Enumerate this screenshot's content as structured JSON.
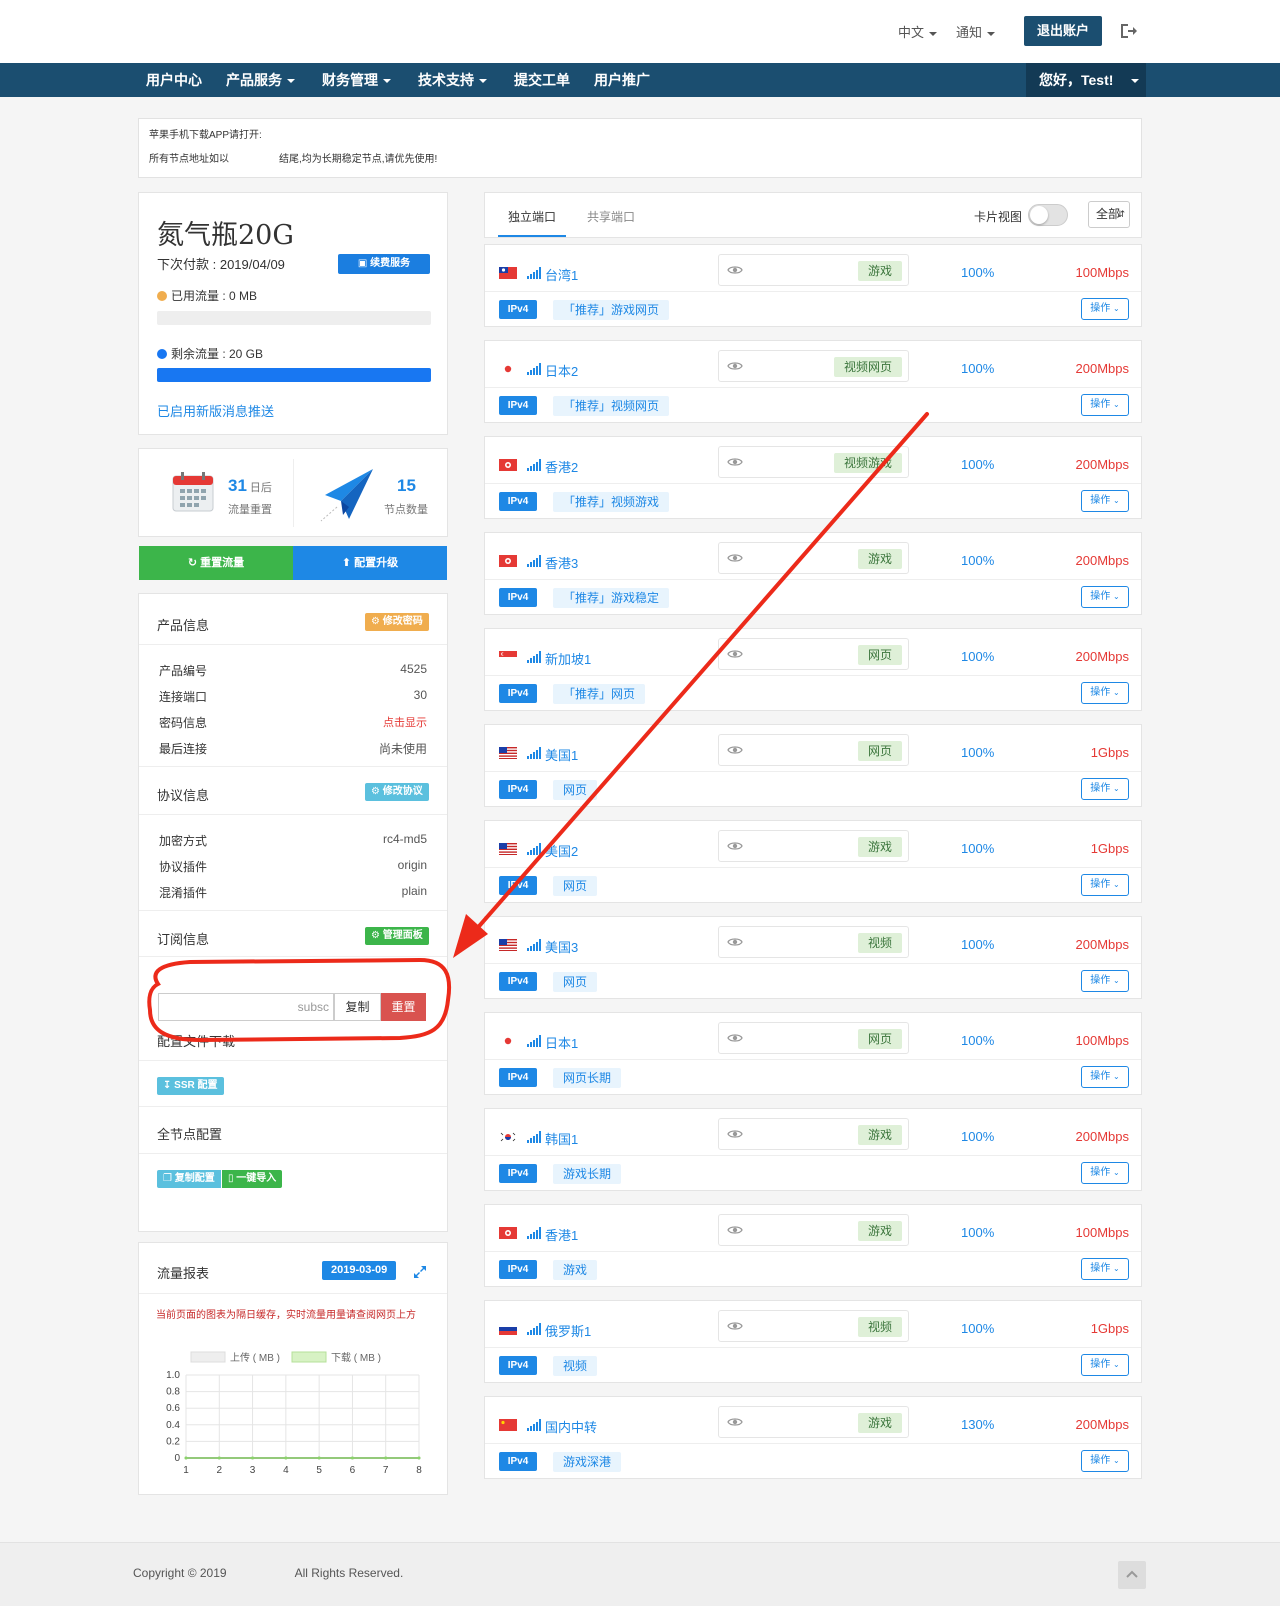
{
  "header": {
    "lang": "中文",
    "notify": "通知",
    "logout": "退出账户"
  },
  "nav": {
    "items": [
      "用户中心",
      "产品服务",
      "财务管理",
      "技术支持",
      "提交工单",
      "用户推广"
    ],
    "user": "您好，Test!"
  },
  "notice": {
    "line1": "苹果手机下载APP请打开:",
    "line2a": "所有节点地址如以",
    "line2b": "结尾,均为长期稳定节点,请优先使用!"
  },
  "plan": {
    "title": "氮气瓶20G",
    "next_payment": "下次付款 : 2019/04/09",
    "renew": "续费服务",
    "used": "已用流量 : 0 MB",
    "used_fraction": 0,
    "remaining": "剩余流量 : 20 GB",
    "remaining_fraction": 1,
    "msg_link": "已启用新版消息推送",
    "used_color": "#f0ad4e",
    "remain_color": "#1877f2"
  },
  "stats": {
    "reset_days": "31",
    "reset_days_unit": "日后",
    "reset_label": "流量重置",
    "nodes": "15",
    "nodes_label": "节点数量"
  },
  "actions": {
    "reset_traffic": "重置流量",
    "upgrade": "配置升级"
  },
  "product": {
    "title": "产品信息",
    "change_pwd": "修改密码",
    "rows": [
      {
        "k": "产品编号",
        "v": "4525"
      },
      {
        "k": "连接端口",
        "v": "30"
      },
      {
        "k": "密码信息",
        "v": "点击显示"
      },
      {
        "k": "最后连接",
        "v": "尚未使用"
      }
    ]
  },
  "protocol": {
    "title": "协议信息",
    "change": "修改协议",
    "rows": [
      {
        "k": "加密方式",
        "v": "rc4-md5"
      },
      {
        "k": "协议插件",
        "v": "origin"
      },
      {
        "k": "混淆插件",
        "v": "plain"
      }
    ]
  },
  "subscription": {
    "title": "订阅信息",
    "panel": "管理面板",
    "input_value": "subsc",
    "copy": "复制",
    "reset": "重置"
  },
  "config": {
    "title": "配置文件下载",
    "ssr": "SSR 配置",
    "all_title": "全节点配置",
    "copy_config": "复制配置",
    "import": "一键导入"
  },
  "traffic": {
    "title": "流量报表",
    "date": "2019-03-09",
    "note": "当前页面的图表为隔日缓存，实时流量用量请查阅网页上方",
    "legend_up": "上传 ( MB )",
    "legend_down": "下载 ( MB )"
  },
  "chart_data": {
    "type": "line",
    "x": [
      1,
      2,
      3,
      4,
      5,
      6,
      7,
      8
    ],
    "series": [
      {
        "name": "上传 ( MB )",
        "values": [
          0,
          0,
          0,
          0,
          0,
          0,
          0,
          0
        ]
      },
      {
        "name": "下载 ( MB )",
        "values": [
          0,
          0,
          0,
          0,
          0,
          0,
          0,
          0
        ]
      }
    ],
    "yticks": [
      "1.0",
      "0.8",
      "0.6",
      "0.4",
      "0.2",
      "0"
    ],
    "xticks": [
      "1",
      "2",
      "3",
      "4",
      "5",
      "6",
      "7",
      "8"
    ],
    "ylim": [
      0,
      1
    ],
    "grid": true
  },
  "right": {
    "tab_dedicated": "独立端口",
    "tab_shared": "共享端口",
    "card_view": "卡片视图",
    "filter": "全部"
  },
  "nodes": [
    {
      "name": "台湾1",
      "flag": "tw",
      "tag": "游戏",
      "pct": "100%",
      "speed": "100Mbps",
      "ip": "IPv4",
      "desc": "「推荐」游戏网页",
      "op": "操作"
    },
    {
      "name": "日本2",
      "flag": "jp",
      "tag": "视频网页",
      "pct": "100%",
      "speed": "200Mbps",
      "ip": "IPv4",
      "desc": "「推荐」视频网页",
      "op": "操作"
    },
    {
      "name": "香港2",
      "flag": "hk",
      "tag": "视频游戏",
      "pct": "100%",
      "speed": "200Mbps",
      "ip": "IPv4",
      "desc": "「推荐」视频游戏",
      "op": "操作"
    },
    {
      "name": "香港3",
      "flag": "hk",
      "tag": "游戏",
      "pct": "100%",
      "speed": "200Mbps",
      "ip": "IPv4",
      "desc": "「推荐」游戏稳定",
      "op": "操作"
    },
    {
      "name": "新加坡1",
      "flag": "sg",
      "tag": "网页",
      "pct": "100%",
      "speed": "200Mbps",
      "ip": "IPv4",
      "desc": "「推荐」网页",
      "op": "操作"
    },
    {
      "name": "美国1",
      "flag": "us",
      "tag": "网页",
      "pct": "100%",
      "speed": "1Gbps",
      "ip": "IPv4",
      "desc": "网页",
      "op": "操作"
    },
    {
      "name": "美国2",
      "flag": "us",
      "tag": "游戏",
      "pct": "100%",
      "speed": "1Gbps",
      "ip": "IPv4",
      "desc": "网页",
      "op": "操作"
    },
    {
      "name": "美国3",
      "flag": "us",
      "tag": "视频",
      "pct": "100%",
      "speed": "200Mbps",
      "ip": "IPv4",
      "desc": "网页",
      "op": "操作"
    },
    {
      "name": "日本1",
      "flag": "jp",
      "tag": "网页",
      "pct": "100%",
      "speed": "100Mbps",
      "ip": "IPv4",
      "desc": "网页长期",
      "op": "操作"
    },
    {
      "name": "韩国1",
      "flag": "kr",
      "tag": "游戏",
      "pct": "100%",
      "speed": "200Mbps",
      "ip": "IPv4",
      "desc": "游戏长期",
      "op": "操作"
    },
    {
      "name": "香港1",
      "flag": "hk",
      "tag": "游戏",
      "pct": "100%",
      "speed": "100Mbps",
      "ip": "IPv4",
      "desc": "游戏",
      "op": "操作"
    },
    {
      "name": "俄罗斯1",
      "flag": "ru",
      "tag": "视频",
      "pct": "100%",
      "speed": "1Gbps",
      "ip": "IPv4",
      "desc": "视频",
      "op": "操作"
    },
    {
      "name": "国内中转",
      "flag": "cn",
      "tag": "游戏",
      "pct": "130%",
      "speed": "200Mbps",
      "ip": "IPv4",
      "desc": "游戏深港",
      "op": "操作"
    }
  ],
  "footer": {
    "copyright_a": "Copyright © 2019",
    "copyright_b": "All Rights Reserved."
  }
}
